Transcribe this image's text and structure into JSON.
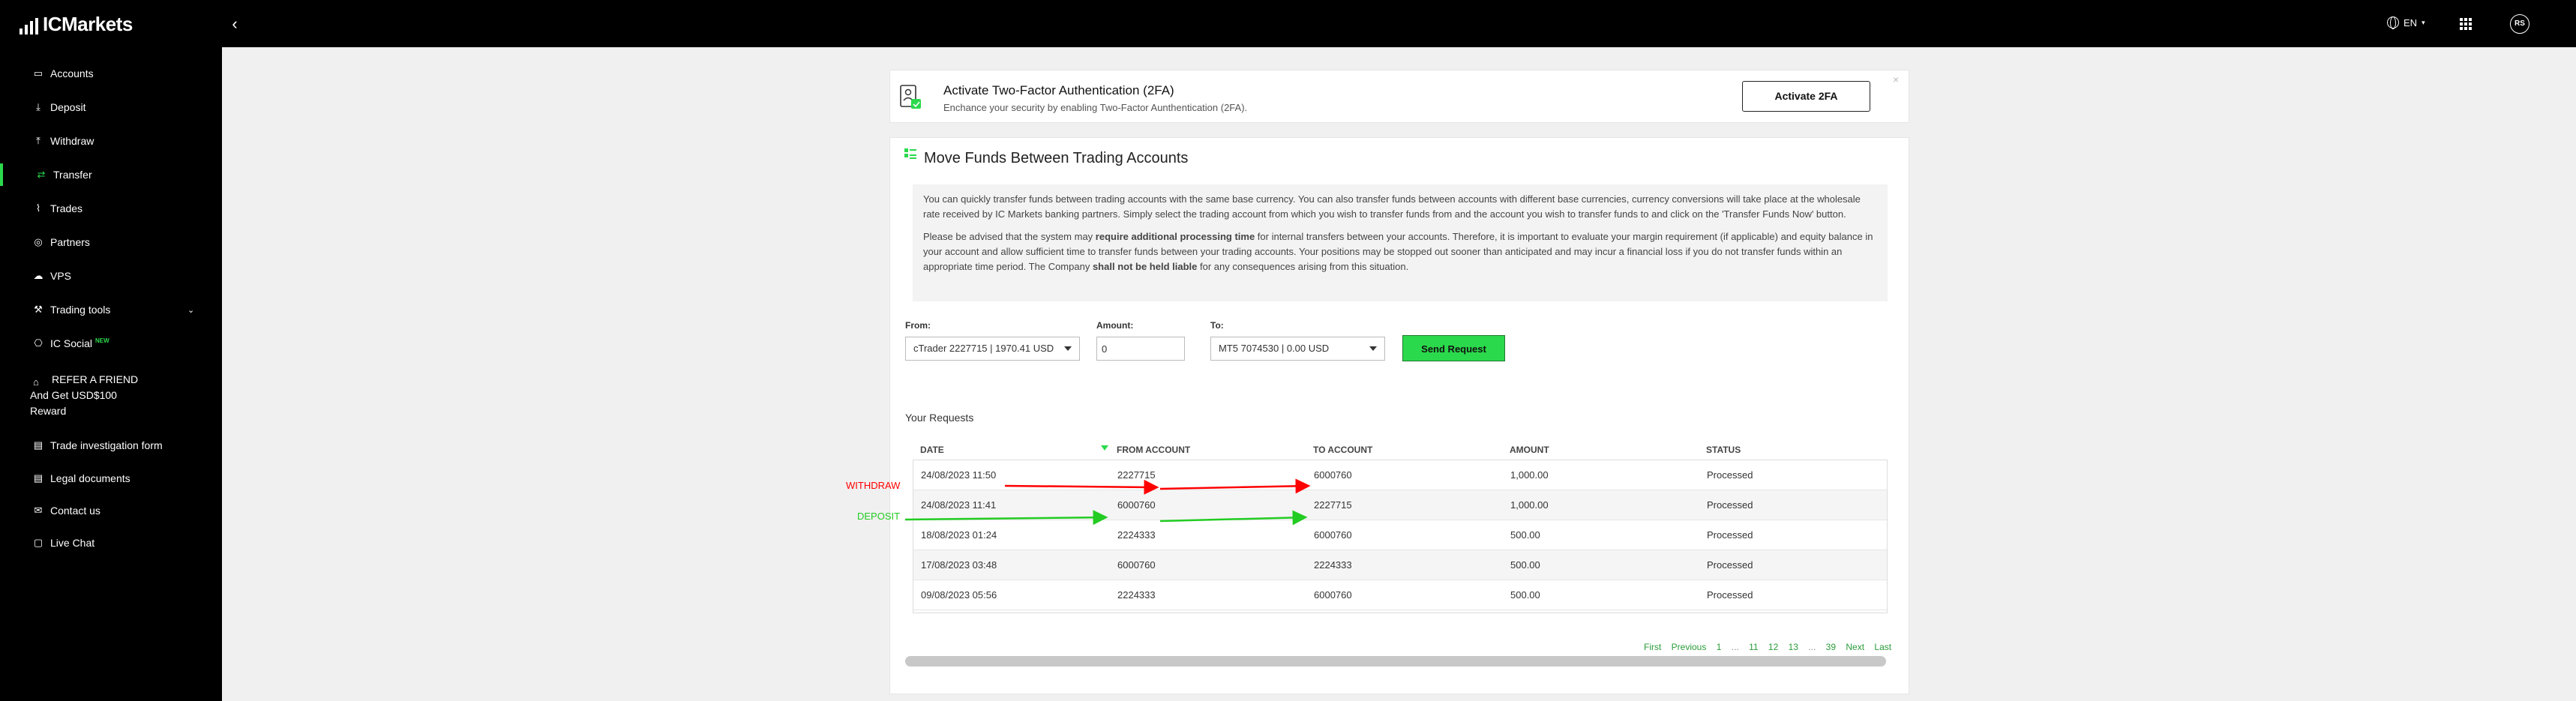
{
  "brand": {
    "name": "ICMarkets"
  },
  "topbar": {
    "language": "EN",
    "avatar_initials": "RS"
  },
  "sidebar": {
    "items": [
      {
        "label": "Accounts",
        "icon": "accounts-icon"
      },
      {
        "label": "Deposit",
        "icon": "deposit-icon"
      },
      {
        "label": "Withdraw",
        "icon": "withdraw-icon"
      },
      {
        "label": "Transfer",
        "icon": "transfer-icon",
        "active": true
      },
      {
        "label": "Trades",
        "icon": "trades-icon"
      },
      {
        "label": "Partners",
        "icon": "partners-icon"
      },
      {
        "label": "VPS",
        "icon": "vps-icon"
      },
      {
        "label": "Trading tools",
        "icon": "trading-tools-icon"
      },
      {
        "label": "IC Social",
        "icon": "ic-social-icon",
        "badge": "NEW"
      },
      {
        "label": "Trade investigation form",
        "icon": "form-icon"
      },
      {
        "label": "Legal documents",
        "icon": "legal-icon"
      },
      {
        "label": "Contact us",
        "icon": "contact-icon"
      },
      {
        "label": "Live Chat",
        "icon": "chat-icon"
      }
    ],
    "refer": {
      "line1": "REFER A FRIEND",
      "line2": "And Get USD$100",
      "line3": "Reward"
    }
  },
  "twofa": {
    "title": "Activate Two-Factor Authentication (2FA)",
    "subtitle": "Enchance your security by enabling Two-Factor Aunthentication (2FA).",
    "button": "Activate 2FA",
    "close": "×"
  },
  "move": {
    "title": "Move Funds Between Trading Accounts",
    "para1": "You can quickly transfer funds between trading accounts with the same base currency. You can also transfer funds between accounts with different base currencies, currency conversions will take place at the wholesale rate received by IC Markets banking partners. Simply select the trading account from which you wish to transfer funds from and the account you wish to transfer funds to and click on the 'Transfer Funds Now' button.",
    "para2_a": "Please be advised that the system may ",
    "para2_b": "require additional processing time",
    "para2_c": " for internal transfers between your accounts. Therefore, it is important to evaluate your margin requirement (if applicable) and equity balance in your account and allow sufficient time to transfer funds between your trading accounts. Your positions may be stopped out sooner than anticipated and may incur a financial loss if you do not transfer funds within an appropriate time period. The Company ",
    "para2_d": "shall not be held liable",
    "para2_e": " for any consequences arising from this situation.",
    "form": {
      "from_label": "From:",
      "from_value": "cTrader 2227715 | 1970.41 USD",
      "amount_label": "Amount:",
      "amount_value": "0",
      "to_label": "To:",
      "to_value": "MT5 7074530 | 0.00 USD",
      "send_label": "Send Request"
    },
    "requests_title": "Your Requests",
    "table": {
      "headers": {
        "date": "DATE",
        "from": "FROM ACCOUNT",
        "to": "TO ACCOUNT",
        "amount": "AMOUNT",
        "status": "STATUS"
      },
      "rows": [
        {
          "date": "24/08/2023 11:50",
          "from": "2227715",
          "to": "6000760",
          "amount": "1,000.00",
          "status": "Processed"
        },
        {
          "date": "24/08/2023 11:41",
          "from": "6000760",
          "to": "2227715",
          "amount": "1,000.00",
          "status": "Processed"
        },
        {
          "date": "18/08/2023 01:24",
          "from": "2224333",
          "to": "6000760",
          "amount": "500.00",
          "status": "Processed"
        },
        {
          "date": "17/08/2023 03:48",
          "from": "6000760",
          "to": "2224333",
          "amount": "500.00",
          "status": "Processed"
        },
        {
          "date": "09/08/2023 05:56",
          "from": "2224333",
          "to": "6000760",
          "amount": "500.00",
          "status": "Processed"
        }
      ]
    },
    "pagination": {
      "first": "First",
      "previous": "Previous",
      "p1": "1",
      "dots1": "...",
      "p11": "11",
      "p12": "12",
      "p13": "13",
      "dots2": "...",
      "p39": "39",
      "next": "Next",
      "last": "Last"
    }
  },
  "annotations": {
    "withdraw": "WITHDRAW",
    "deposit": "DEPOSIT",
    "withdraw_color": "#ff0000",
    "deposit_color": "#22cc22"
  },
  "colors": {
    "accent": "#2bd94c",
    "topbar": "#000000",
    "page_bg": "#f0f0f0"
  }
}
